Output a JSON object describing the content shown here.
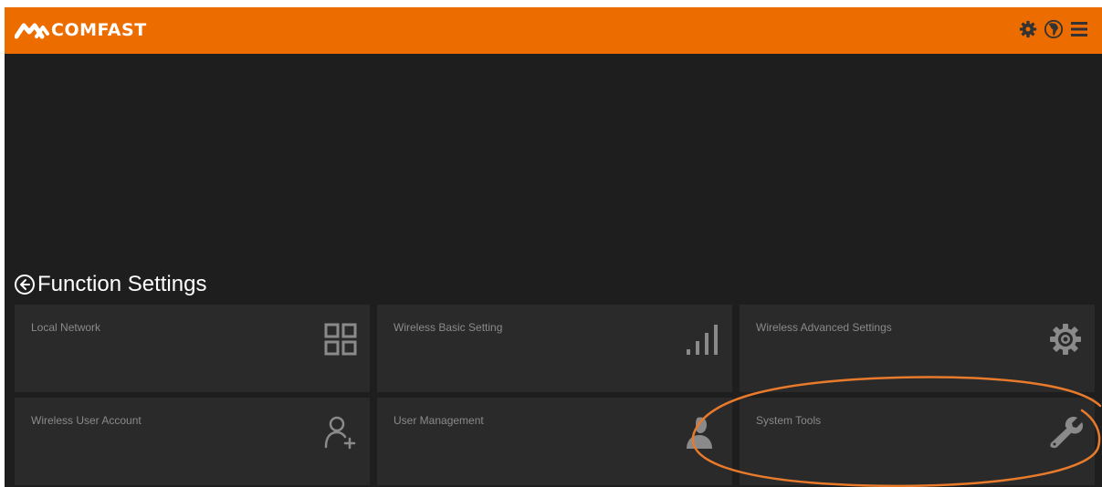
{
  "header": {
    "brand": "COMFAST",
    "brand_color": "#ec6c00",
    "icons": [
      "gear-icon",
      "globe-icon",
      "menu-icon"
    ]
  },
  "section": {
    "title": "Function Settings",
    "back_icon": "back-arrow-icon"
  },
  "tiles": [
    {
      "label": "Local Network",
      "icon": "grid-icon"
    },
    {
      "label": "Wireless Basic Setting",
      "icon": "signal-bars-icon"
    },
    {
      "label": "Wireless Advanced Settings",
      "icon": "gear-icon"
    },
    {
      "label": "Wireless User Account",
      "icon": "add-user-icon"
    },
    {
      "label": "User Management",
      "icon": "user-icon"
    },
    {
      "label": "System Tools",
      "icon": "wrench-icon"
    }
  ],
  "annotation": {
    "shape": "ellipse",
    "color": "#e87a2c",
    "target": "System Tools"
  }
}
